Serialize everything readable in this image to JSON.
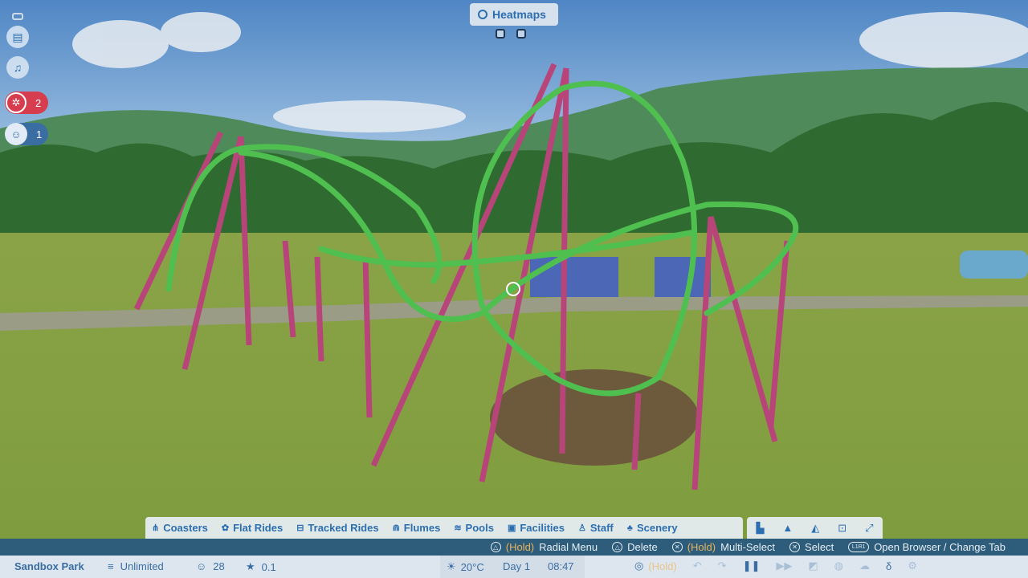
{
  "heatmaps": {
    "label": "Heatmaps"
  },
  "sidebar": {
    "alerts_count": "2",
    "guests_count": "1"
  },
  "build_tabs": [
    {
      "label": "Coasters",
      "icon": "coaster-icon"
    },
    {
      "label": "Flat Rides",
      "icon": "flat-ride-icon"
    },
    {
      "label": "Tracked Rides",
      "icon": "tracked-ride-icon"
    },
    {
      "label": "Flumes",
      "icon": "flume-icon"
    },
    {
      "label": "Pools",
      "icon": "pool-icon"
    },
    {
      "label": "Facilities",
      "icon": "facility-icon"
    },
    {
      "label": "Staff",
      "icon": "staff-icon"
    },
    {
      "label": "Scenery",
      "icon": "scenery-icon"
    }
  ],
  "hints": {
    "radial_hold": "(Hold)",
    "radial_label": "Radial Menu",
    "delete_label": "Delete",
    "multi_hold": "(Hold)",
    "multi_label": "Multi-Select",
    "select_label": "Select",
    "browser_label": "Open Browser / Change Tab"
  },
  "status": {
    "park_name": "Sandbox Park",
    "money": "Unlimited",
    "guests": "28",
    "rating": "0.1",
    "temperature": "20°C",
    "day": "Day 1",
    "time": "08:47",
    "speed_hold": "(Hold)"
  },
  "colors": {
    "track": "#4fbf4f",
    "supports": "#b8457a",
    "ui_blue": "#2c6fb0",
    "alert_red": "#d63d4e"
  }
}
